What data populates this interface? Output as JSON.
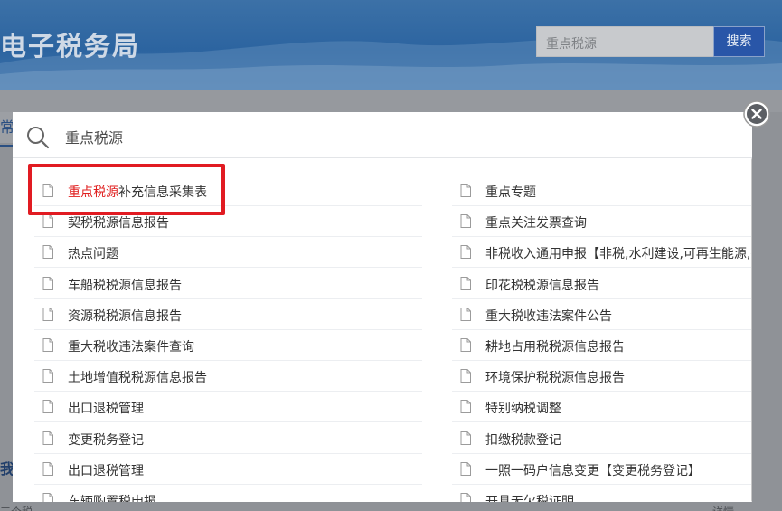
{
  "background": {
    "site_title": "电子税务局",
    "header_search": {
      "value": "重点税源",
      "button_label": "搜索"
    },
    "tab_partial": "常",
    "section_partial": "我",
    "bottom_left_text": "三个税",
    "bottom_right_text": "详情"
  },
  "modal": {
    "search_query": "重点税源",
    "results_left": [
      {
        "highlight": "重点税源",
        "rest": "补充信息采集表"
      },
      {
        "highlight": "",
        "rest": "契税税源信息报告"
      },
      {
        "highlight": "",
        "rest": "热点问题"
      },
      {
        "highlight": "",
        "rest": "车船税税源信息报告"
      },
      {
        "highlight": "",
        "rest": "资源税税源信息报告"
      },
      {
        "highlight": "",
        "rest": "重大税收违法案件查询"
      },
      {
        "highlight": "",
        "rest": "土地增值税税源信息报告"
      },
      {
        "highlight": "",
        "rest": "出口退税管理"
      },
      {
        "highlight": "",
        "rest": "变更税务登记"
      },
      {
        "highlight": "",
        "rest": "出口退税管理"
      },
      {
        "highlight": "",
        "rest": "车辆购置税申报"
      }
    ],
    "results_right": [
      {
        "highlight": "",
        "rest": "重点专题"
      },
      {
        "highlight": "",
        "rest": "重点关注发票查询"
      },
      {
        "highlight": "",
        "rest": "非税收入通用申报【非税,水利建设,可再生能源,残"
      },
      {
        "highlight": "",
        "rest": "印花税税源信息报告"
      },
      {
        "highlight": "",
        "rest": "重大税收违法案件公告"
      },
      {
        "highlight": "",
        "rest": "耕地占用税税源信息报告"
      },
      {
        "highlight": "",
        "rest": "环境保护税税源信息报告"
      },
      {
        "highlight": "",
        "rest": "特别纳税调整"
      },
      {
        "highlight": "",
        "rest": "扣缴税款登记"
      },
      {
        "highlight": "",
        "rest": "一照一码户信息变更【变更税务登记】"
      },
      {
        "highlight": "",
        "rest": "开具无欠税证明"
      }
    ]
  },
  "colors": {
    "highlight": "#e02020",
    "annotation_box": "#e11b22",
    "header_blue": "#2c64a0"
  },
  "icons": [
    "search-icon",
    "document-icon",
    "close-icon"
  ]
}
